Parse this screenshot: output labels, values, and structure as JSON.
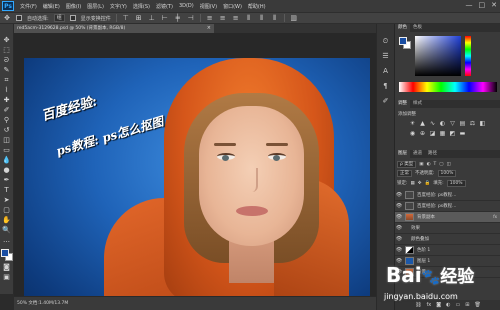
{
  "app": {
    "logo": "Ps"
  },
  "menu": [
    "文件(F)",
    "编辑(E)",
    "图像(I)",
    "图层(L)",
    "文字(Y)",
    "选择(S)",
    "滤镜(T)",
    "3D(D)",
    "视图(V)",
    "窗口(W)",
    "帮助(H)"
  ],
  "window_controls": {
    "minimize": "—",
    "maximize": "□",
    "close": "✕"
  },
  "options": {
    "auto_select_label": "自动选择:",
    "auto_select_value": "组",
    "transform_label": "显示变换控件"
  },
  "document": {
    "tab_title": "red5acm-3129628.psd @ 50% (背景副本, RGB/8)",
    "close": "×"
  },
  "status": {
    "text": "50%    文档:1.40M/13.7M"
  },
  "panels": {
    "color_tabs": [
      "颜色",
      "色板"
    ],
    "adjust_tabs": [
      "调整",
      "样式"
    ],
    "adjust_title": "添加调整",
    "layers_tabs": [
      "图层",
      "通道",
      "路径"
    ],
    "layers_kind": "ρ 类型",
    "blend_mode": "正常",
    "opacity_label": "不透明度:",
    "opacity_value": "100%",
    "lock_label": "锁定:",
    "fill_label": "填充:",
    "fill_value": "100%"
  },
  "layers": [
    {
      "name": "百度经验: ps教程...",
      "kind": "text",
      "fx": ""
    },
    {
      "name": "百度经验: ps教程...",
      "kind": "text",
      "fx": ""
    },
    {
      "name": "背景副本",
      "kind": "photo",
      "fx": "fx"
    },
    {
      "name": "效果",
      "kind": "text",
      "fx": ""
    },
    {
      "name": "颜色叠加",
      "kind": "text",
      "fx": ""
    },
    {
      "name": "色阶 1",
      "kind": "adj",
      "fx": ""
    },
    {
      "name": "图层 1",
      "kind": "blue",
      "fx": ""
    },
    {
      "name": "背景",
      "kind": "photo",
      "fx": ""
    }
  ],
  "canvas_text": {
    "line1": "百度经验:",
    "line2": "ps教程: ps怎么抠图"
  },
  "watermark": {
    "logo_prefix": "Bai",
    "logo_paw": "🐾",
    "logo_suffix": "经验",
    "url": "jingyan.baidu.com"
  },
  "colors": {
    "canvas_bg": "#1f63b8",
    "hood": "#d5561a",
    "foreground": "#1a4ea3",
    "background": "#ffffff"
  }
}
